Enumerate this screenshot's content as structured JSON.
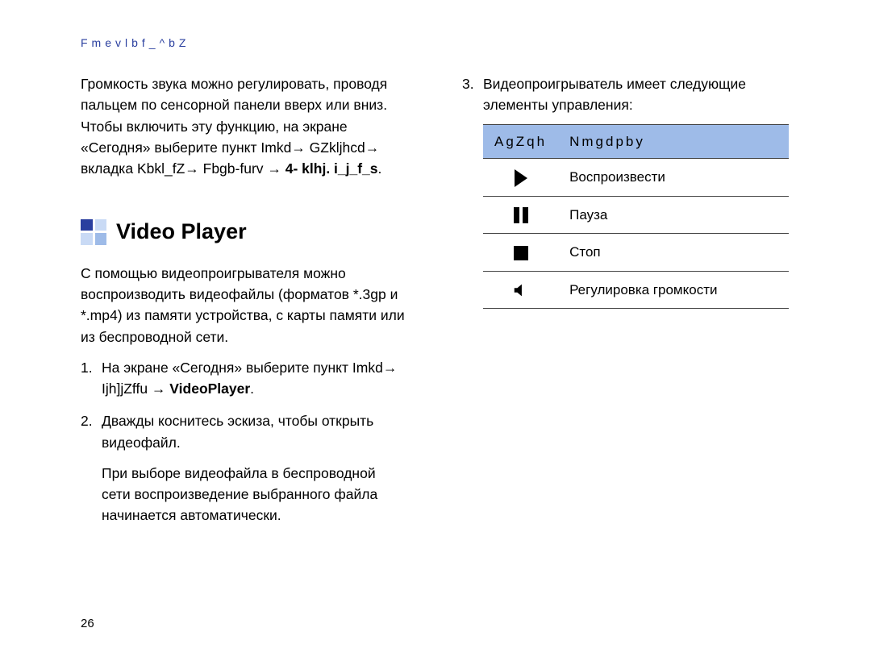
{
  "running_head": "Fmevlbf_^bZ",
  "left_col": {
    "para1": "Громкость звука можно регулировать, проводя пальцем по сенсорной панели вверх или вниз. Чтобы включить эту функцию, на экране «Сегодня» выберите пункт Imkd→ GZkljhcd→ вкладка Kbkl_fZ→ Fbgb-furv → ",
    "bold1": "4- klhj. i_j_f_s",
    "after1": ".",
    "section_title": "Video Player",
    "para2": "С помощью видеопроигрывателя можно воспроизводить видеофайлы (форматов *.3gp и *.mp4) из памяти устройства, с карты памяти или из беспроводной сети.",
    "ol": [
      {
        "pre": "На экране «Сегодня» выберите пункт Imkd→ Ijh]jZffu → ",
        "bold": "VideoPlayer",
        "post": "."
      },
      {
        "text": "Дважды коснитесь эскиза, чтобы открыть видеофайл.",
        "sub": "При выборе видеофайла в беспроводной сети воспроизведение выбранного файла начинается автоматически."
      }
    ]
  },
  "right_col": {
    "li3": "Видеопроигрыватель имеет следующие элементы управления:",
    "table": {
      "headers": [
        "AgZqh",
        "Nmgdpby"
      ],
      "rows": [
        {
          "icon": "play",
          "name": "play-icon",
          "label": "Воспроизвести"
        },
        {
          "icon": "pause",
          "name": "pause-icon",
          "label": "Пауза"
        },
        {
          "icon": "stop",
          "name": "stop-icon",
          "label": "Стоп"
        },
        {
          "icon": "vol",
          "name": "volume-icon",
          "label": "Регулировка громкости"
        }
      ]
    }
  },
  "page_number": "26",
  "tile_colors": [
    "#2a3f9f",
    "#c9daf5",
    "#c9daf5",
    "#9ebbe8"
  ]
}
